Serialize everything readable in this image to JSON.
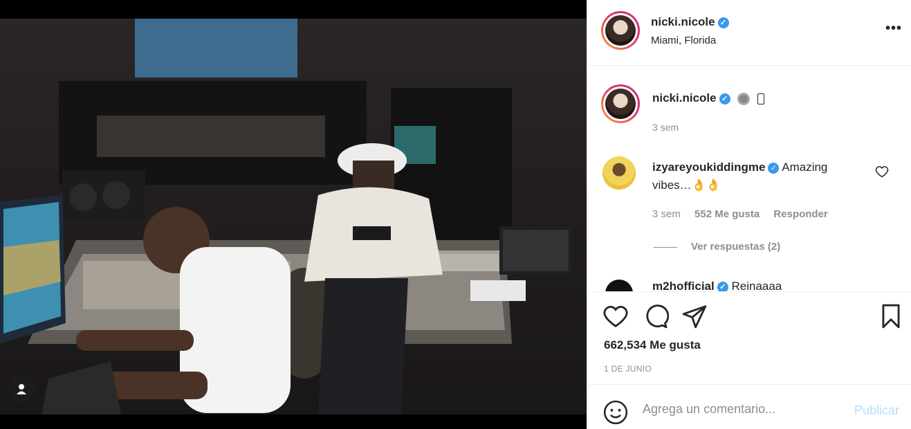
{
  "header": {
    "username": "nicki.nicole",
    "location": "Miami, Florida",
    "more_label": "•••"
  },
  "caption": {
    "username": "nicki.nicole",
    "time": "3 sem"
  },
  "comment": {
    "username": "izyareyoukiddingme",
    "text": "Amazing vibes…👌👌",
    "time": "3 sem",
    "likes": "552 Me gusta",
    "reply_label": "Responder",
    "view_replies": "Ver respuestas (2)"
  },
  "next_comment": {
    "username": "m2hofficial",
    "text": "Reinaaaa"
  },
  "actions": {
    "likes_count": "662,534 Me gusta",
    "date": "1 DE JUNIO"
  },
  "add_comment": {
    "placeholder": "Agrega un comentario...",
    "publish_label": "Publicar"
  },
  "colors": {
    "verified": "#3897f0",
    "publish_disabled": "#b2dffc",
    "muted": "#8e8e8e"
  }
}
